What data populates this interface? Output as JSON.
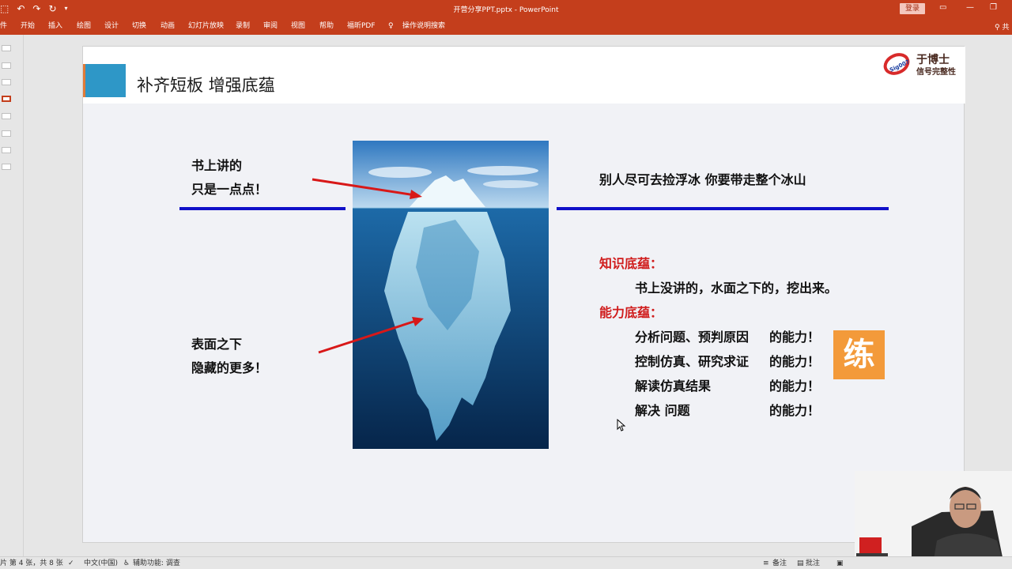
{
  "titlebar": {
    "quick_access": [
      "↶",
      "↷",
      "↻"
    ],
    "title": "开营分享PPT.pptx  -  PowerPoint",
    "login_label": "登录"
  },
  "ribbon": {
    "tabs": [
      "开始",
      "插入",
      "绘图",
      "设计",
      "切换",
      "动画",
      "幻灯片放映",
      "录制",
      "审阅",
      "视图",
      "帮助",
      "福昕PDF",
      "操作说明搜索"
    ],
    "share_label": "共"
  },
  "slide": {
    "title": "补齐短板 增强底蕴",
    "logo": {
      "name": "于博士",
      "subtitle": "信号完整性",
      "ring_text": "Sig007"
    },
    "left_top": [
      "书上讲的",
      "只是一点点！"
    ],
    "left_bottom": [
      "表面之下",
      "隐藏的更多！"
    ],
    "right_heading": "别人尽可去捡浮冰   你要带走整个冰山",
    "knowledge": {
      "heading": "知识底蕴：",
      "line": "书上没讲的，水面之下的，挖出来。"
    },
    "ability": {
      "heading": "能力底蕴：",
      "items": [
        {
          "left": "分析问题、预判原因",
          "right": "的能力！"
        },
        {
          "left": "控制仿真、研究求证",
          "right": "的能力！"
        },
        {
          "left": "解读仿真结果",
          "right": "的能力！"
        },
        {
          "left": "解决 问题",
          "right": "的能力！"
        }
      ]
    },
    "badge": "练"
  },
  "statusbar": {
    "slide_info": "片 第 4 张，共 8 张",
    "language": "中文(中国)",
    "accessibility": "辅助功能: 调查",
    "notes": "备注",
    "comments": "批注"
  },
  "colors": {
    "ribbon": "#c43e1c",
    "header_square": "#2e97c7",
    "divider_bar": "#1010c8",
    "emphasis_red": "#d01c1c",
    "badge_bg": "#f39a3a"
  }
}
